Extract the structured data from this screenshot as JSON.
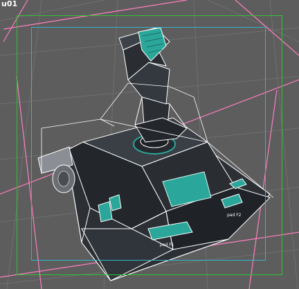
{
  "viewport": {
    "label": "u01",
    "mode": "perspective wireframe-on-shaded",
    "colors": {
      "background": "#5d5d5d",
      "grid": "#6f6f6f",
      "wire": "#ffffff",
      "selection_bounds": "#ff7fbf",
      "safe_frame_outer": "#2fc42f",
      "safe_frame_inner": "#35b3c8",
      "model_dark": "#23272c",
      "model_mid": "#3a3f45",
      "screen_teal": "#2aa79a"
    }
  },
  "model": {
    "name": "joystick-base",
    "parts": [
      "stick-handle",
      "button-pad",
      "base-plate",
      "front-panel",
      "side-mount"
    ],
    "labels": {
      "left_panel": "pad F1",
      "right_panel": "pad F2"
    }
  }
}
